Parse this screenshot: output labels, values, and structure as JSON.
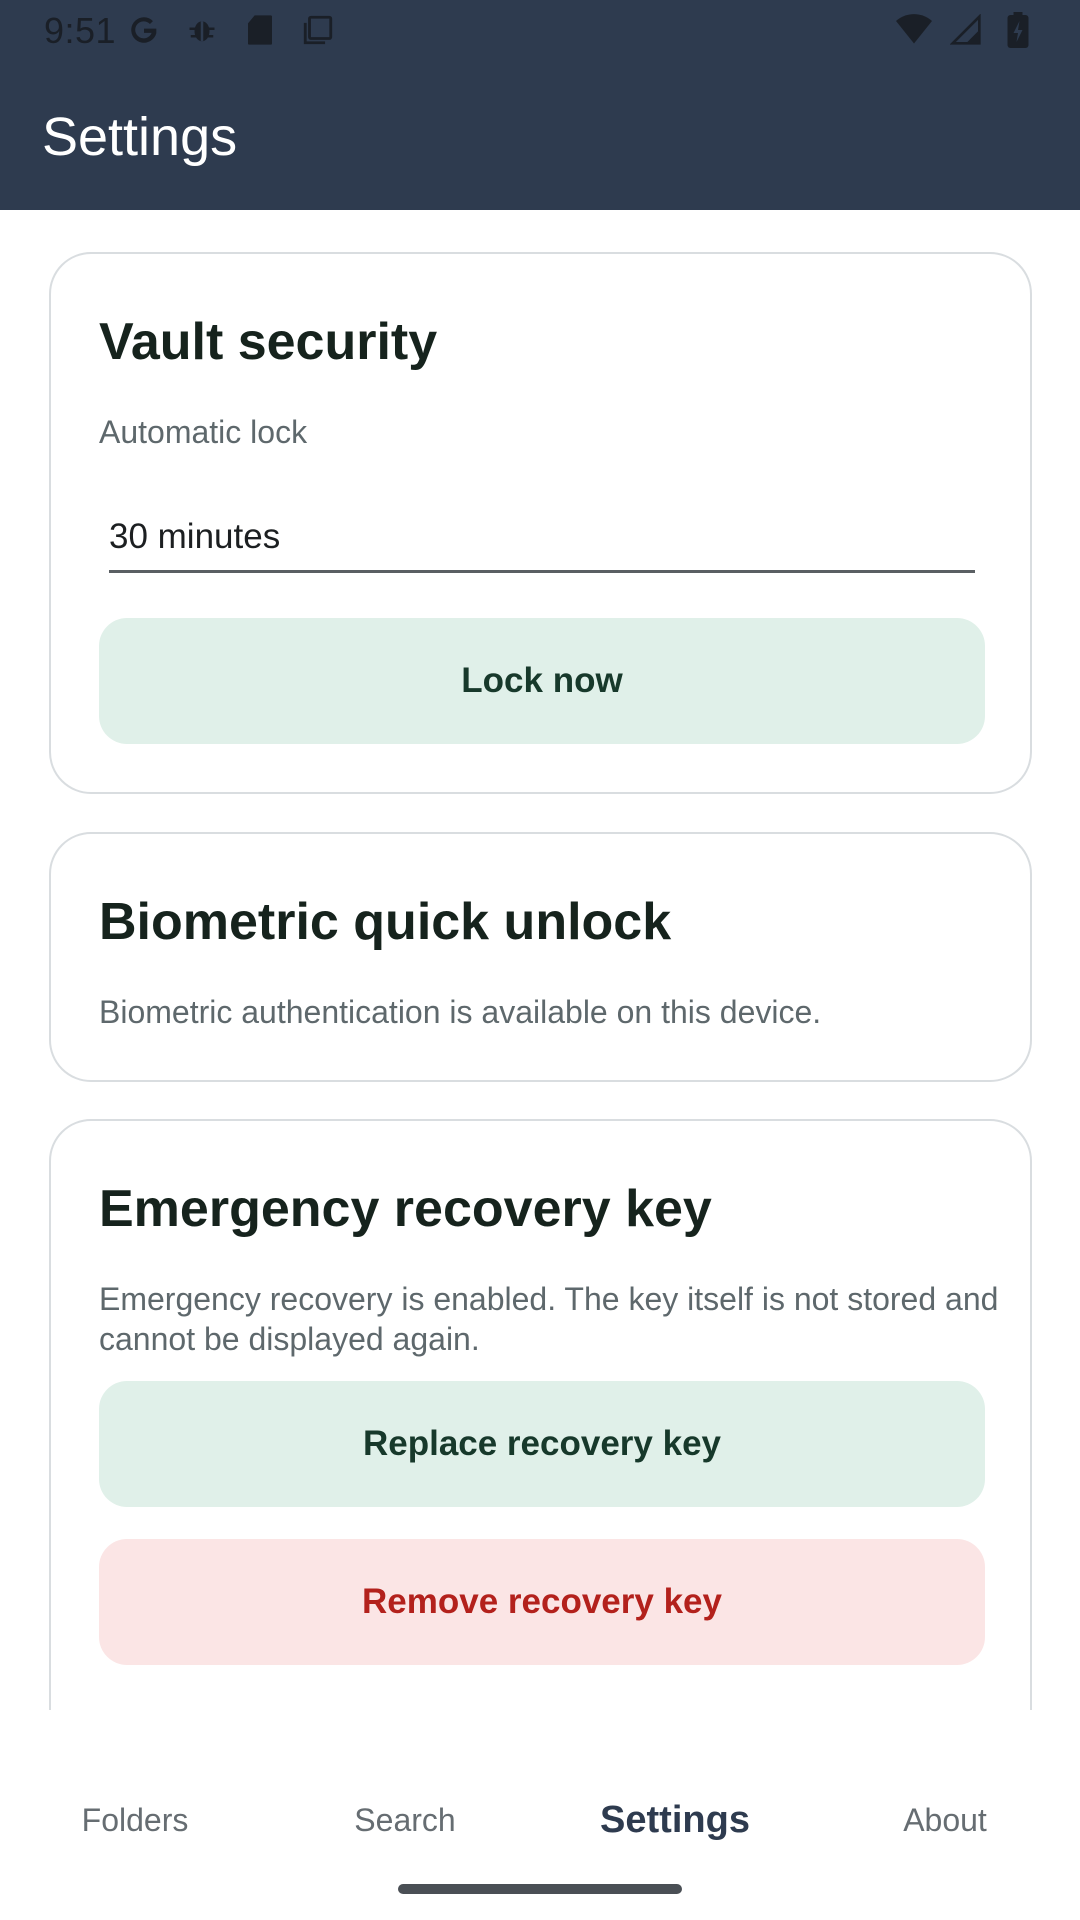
{
  "status_bar": {
    "time": "9:51",
    "left_icons": [
      "google-icon",
      "bug-icon",
      "sd-card-icon",
      "copy-icon"
    ],
    "right_icons": [
      "wifi-icon",
      "signal-icon",
      "battery-icon"
    ]
  },
  "app_bar": {
    "title": "Settings"
  },
  "vault_security": {
    "title": "Vault security",
    "auto_lock_label": "Automatic lock",
    "auto_lock_value": "30 minutes",
    "lock_now_label": "Lock now"
  },
  "biometric": {
    "title": "Biometric quick unlock",
    "description": "Biometric authentication is available on this device."
  },
  "recovery": {
    "title": "Emergency recovery key",
    "description": "Emergency recovery is enabled. The key itself is not stored and cannot be displayed again.",
    "replace_label": "Replace recovery key",
    "remove_label": "Remove recovery key"
  },
  "bottom_nav": {
    "items": [
      {
        "label": "Folders",
        "active": false
      },
      {
        "label": "Search",
        "active": false
      },
      {
        "label": "Settings",
        "active": true
      },
      {
        "label": "About",
        "active": false
      }
    ]
  },
  "colors": {
    "app_bar": "#2e3b4f",
    "primary_button_bg": "#e0f0e9",
    "danger_button_bg": "#fbe5e5",
    "danger_text": "#b3211c"
  }
}
